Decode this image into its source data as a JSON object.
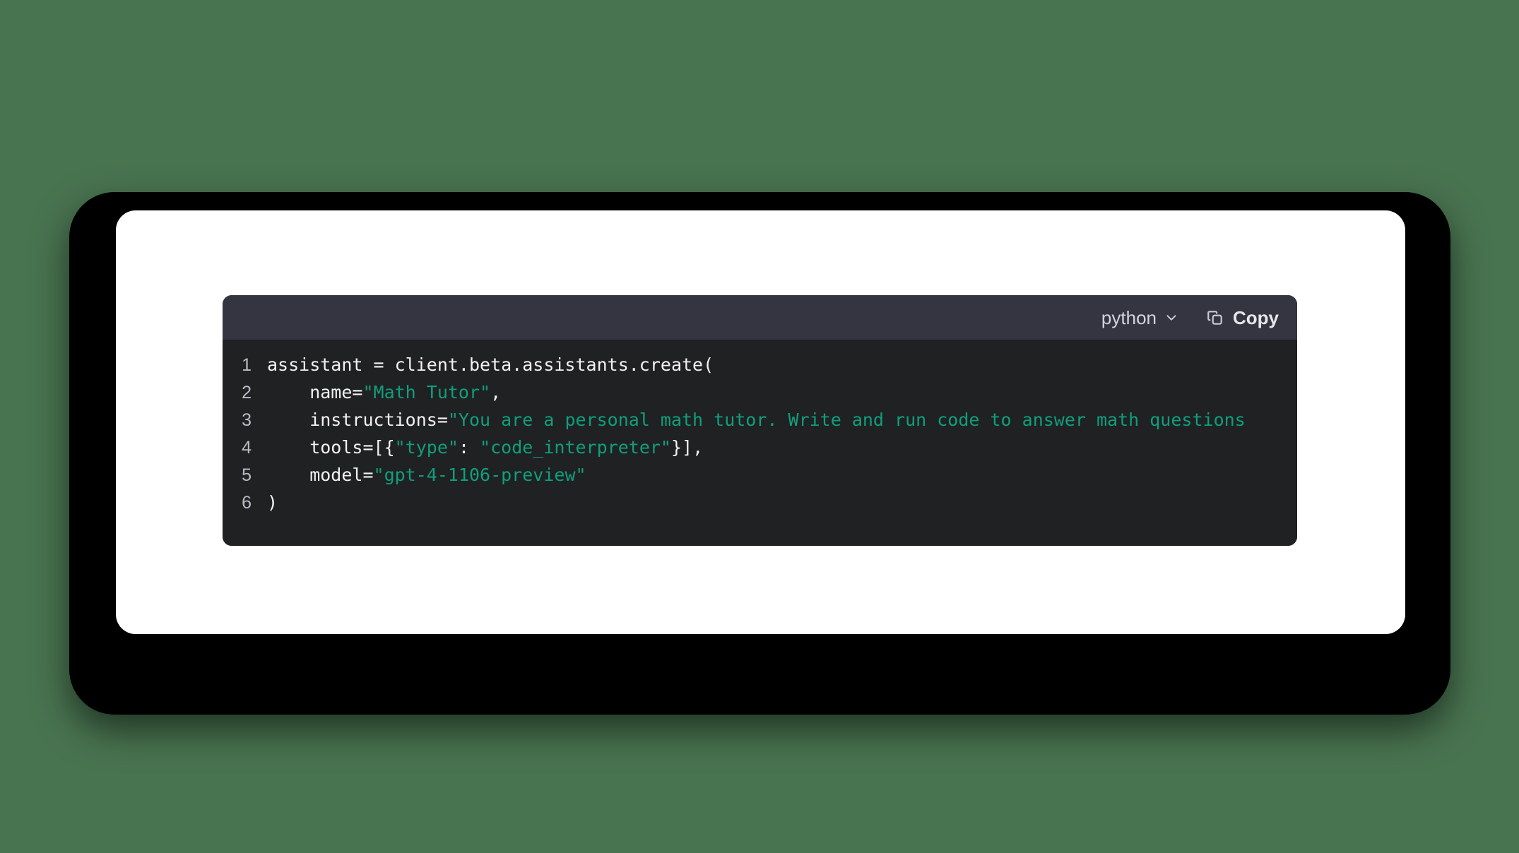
{
  "theme": {
    "page_background": "#497450",
    "frame_color": "#000000",
    "card_color": "#ffffff",
    "code_header_bg": "#343541",
    "code_body_bg": "#202123",
    "string_color": "#0f9f7d",
    "code_text_color": "#f2f2f3",
    "line_number_color": "#b9bdc6"
  },
  "code_block": {
    "header": {
      "language_label": "python",
      "chevron_icon": "chevron-down-icon",
      "copy_icon": "copy-icon",
      "copy_label": "Copy"
    },
    "lines": [
      {
        "number": "1",
        "segments": [
          {
            "type": "plain",
            "text": "assistant = client.beta.assistants.create("
          }
        ]
      },
      {
        "number": "2",
        "segments": [
          {
            "type": "plain",
            "text": "    name="
          },
          {
            "type": "string",
            "text": "\"Math Tutor\""
          },
          {
            "type": "plain",
            "text": ","
          }
        ]
      },
      {
        "number": "3",
        "segments": [
          {
            "type": "plain",
            "text": "    instructions="
          },
          {
            "type": "string",
            "text": "\"You are a personal math tutor. Write and run code to answer math questions"
          }
        ]
      },
      {
        "number": "4",
        "segments": [
          {
            "type": "plain",
            "text": "    tools=[{"
          },
          {
            "type": "string",
            "text": "\"type\""
          },
          {
            "type": "plain",
            "text": ": "
          },
          {
            "type": "string",
            "text": "\"code_interpreter\""
          },
          {
            "type": "plain",
            "text": "}],"
          }
        ]
      },
      {
        "number": "5",
        "segments": [
          {
            "type": "plain",
            "text": "    model="
          },
          {
            "type": "string",
            "text": "\"gpt-4-1106-preview\""
          }
        ]
      },
      {
        "number": "6",
        "segments": [
          {
            "type": "plain",
            "text": ")"
          }
        ]
      }
    ]
  }
}
